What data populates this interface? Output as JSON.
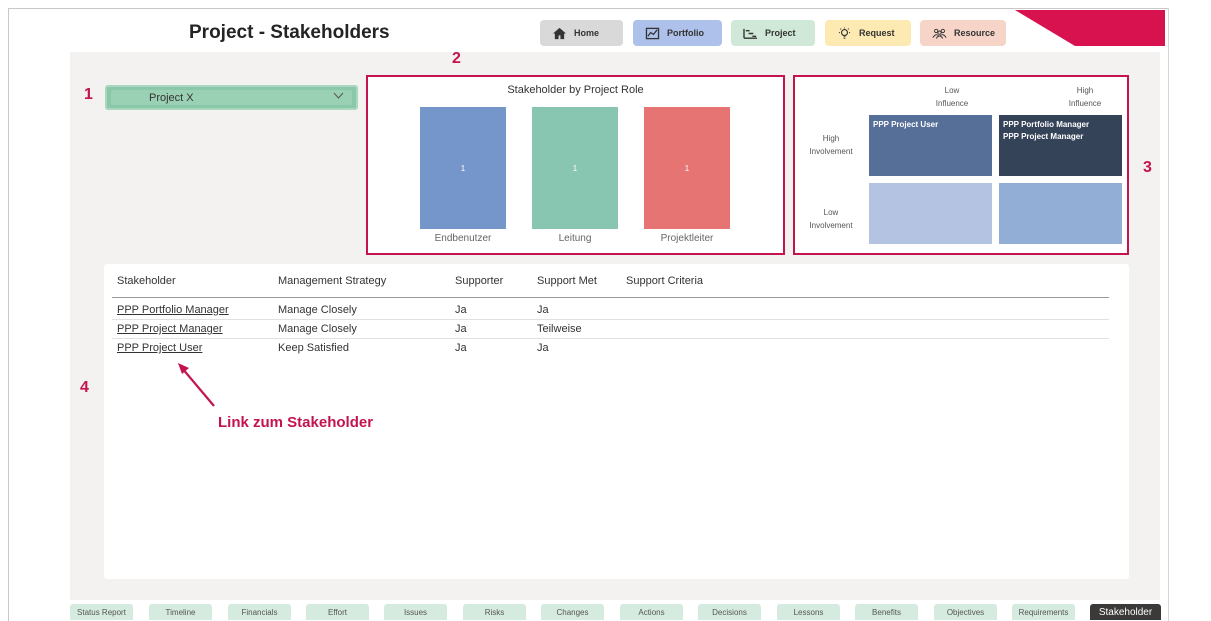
{
  "page_title": "Project - Stakeholders",
  "nav": [
    {
      "label": "Home",
      "icon": "home-icon",
      "bg": "#d9d9d9"
    },
    {
      "label": "Portfolio",
      "icon": "portfolio-chart-icon",
      "bg": "#adc1ea"
    },
    {
      "label": "Project",
      "icon": "gantt-icon",
      "bg": "#cfe8d7"
    },
    {
      "label": "Request",
      "icon": "lightbulb-icon",
      "bg": "#fde9b2"
    },
    {
      "label": "Resource",
      "icon": "people-icon",
      "bg": "#f7d4c8"
    }
  ],
  "callouts": {
    "one": "1",
    "two": "2",
    "three": "3",
    "four": "4"
  },
  "project_select": {
    "value": "Project X"
  },
  "role_chart": {
    "title": "Stakeholder by Project Role",
    "chart_data": {
      "type": "bar",
      "title": "Stakeholder by Project Role",
      "categories": [
        "Endbenutzer",
        "Leitung",
        "Projektleiter"
      ],
      "values": [
        1,
        1,
        1
      ],
      "colors": [
        "#7596cb",
        "#88c6b2",
        "#e67472"
      ]
    }
  },
  "matrix": {
    "col_low": [
      "Low",
      "Influence"
    ],
    "col_high": [
      "High",
      "Influence"
    ],
    "row_high": [
      "High",
      "Involvement"
    ],
    "row_low": [
      "Low",
      "Involvement"
    ],
    "cells": {
      "high_involvement_low_influence": [
        "PPP Project User"
      ],
      "high_involvement_high_influence": [
        "PPP Portfolio Manager",
        "PPP Project Manager"
      ],
      "low_involvement_low_influence": [],
      "low_involvement_high_influence": []
    },
    "colors": {
      "hl": "#566f98",
      "hh": "#354359",
      "ll": "#b3c3e1",
      "lh": "#93aed6"
    }
  },
  "table": {
    "headers": [
      "Stakeholder",
      "Management Strategy",
      "Supporter",
      "Support Met",
      "Support Criteria"
    ],
    "rows": [
      [
        "PPP Portfolio Manager",
        "Manage Closely",
        "Ja",
        "Ja",
        ""
      ],
      [
        "PPP Project Manager",
        "Manage Closely",
        "Ja",
        "Teilweise",
        ""
      ],
      [
        "PPP Project User",
        "Keep Satisfied",
        "Ja",
        "Ja",
        ""
      ]
    ]
  },
  "annotation": "Link zum Stakeholder",
  "tabs": [
    "Status Report",
    "Timeline",
    "Financials",
    "Effort",
    "Issues",
    "Risks",
    "Changes",
    "Actions",
    "Decisions",
    "Lessons",
    "Benefits",
    "Objectives",
    "Requirements",
    "Stakeholder"
  ],
  "active_tab": "Stakeholder",
  "accent_color": "#d8124e"
}
